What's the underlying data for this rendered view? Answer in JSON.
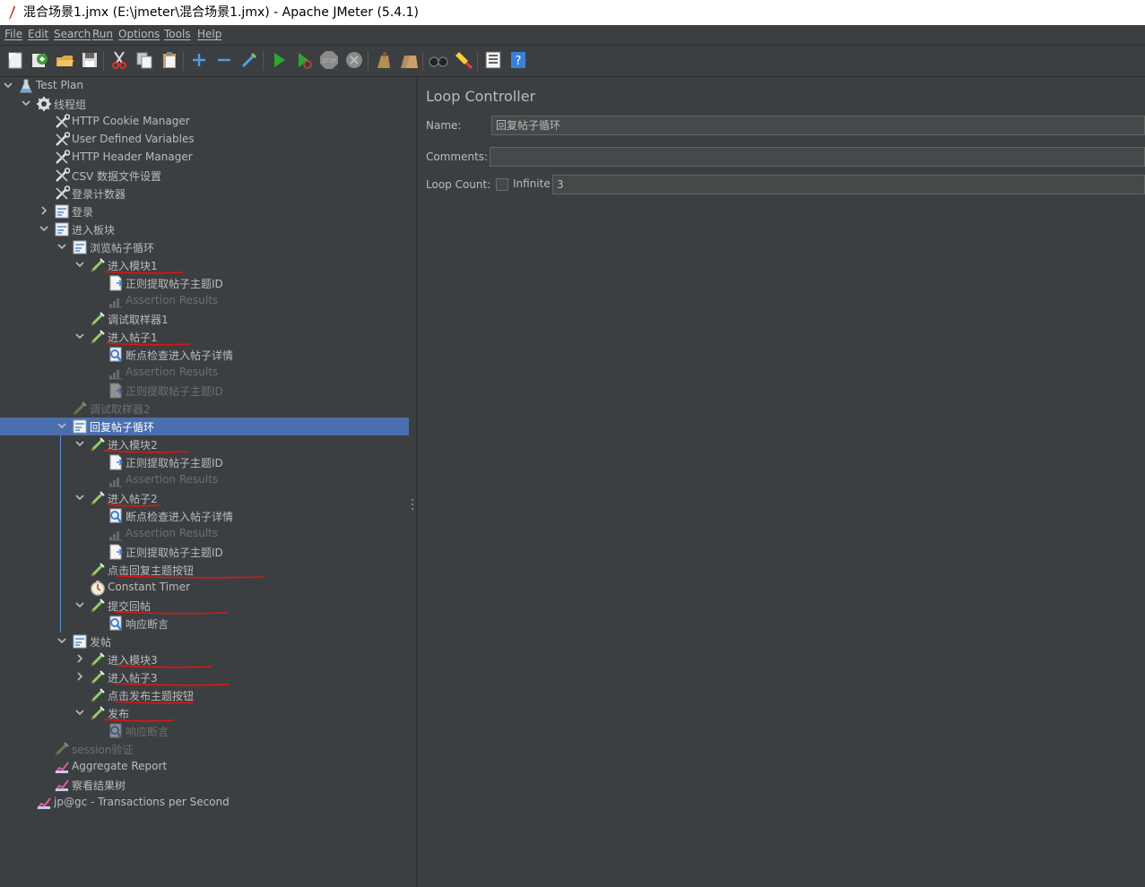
{
  "window": {
    "title": "混合场景1.jmx (E:\\jmeter\\混合场景1.jmx) - Apache JMeter (5.4.1)"
  },
  "menu": [
    "File",
    "Edit",
    "Search",
    "Run",
    "Options",
    "Tools",
    "Help"
  ],
  "toolbar": [
    "new-icon",
    "templates-icon",
    "open-icon",
    "save-icon",
    "cut-icon",
    "copy-icon",
    "paste-icon",
    "expand-icon",
    "collapse-icon",
    "toggle-icon",
    "start-icon",
    "start-no-timers-icon",
    "stop-icon",
    "shutdown-icon",
    "clear-icon",
    "clear-all-icon",
    "search-icon",
    "reset-search-icon",
    "function-helper-icon",
    "help-icon"
  ],
  "tree": [
    {
      "label": "Test Plan",
      "icon": "testplan-icon",
      "depth": 0,
      "arrow": "down",
      "disabled": false,
      "selected": false
    },
    {
      "label": "线程组",
      "icon": "gear-icon",
      "depth": 1,
      "arrow": "down",
      "disabled": false,
      "selected": false
    },
    {
      "label": "HTTP Cookie Manager",
      "icon": "wrench-icon",
      "depth": 2,
      "arrow": "",
      "disabled": false,
      "selected": false
    },
    {
      "label": "User Defined Variables",
      "icon": "wrench-icon",
      "depth": 2,
      "arrow": "",
      "disabled": false,
      "selected": false
    },
    {
      "label": "HTTP Header Manager",
      "icon": "wrench-icon",
      "depth": 2,
      "arrow": "",
      "disabled": false,
      "selected": false
    },
    {
      "label": "CSV 数据文件设置",
      "icon": "wrench-icon",
      "depth": 2,
      "arrow": "",
      "disabled": false,
      "selected": false
    },
    {
      "label": "登录计数器",
      "icon": "wrench-icon",
      "depth": 2,
      "arrow": "",
      "disabled": false,
      "selected": false
    },
    {
      "label": "登录",
      "icon": "controller-icon",
      "depth": 2,
      "arrow": "right",
      "disabled": false,
      "selected": false
    },
    {
      "label": "进入板块",
      "icon": "controller-icon",
      "depth": 2,
      "arrow": "down",
      "disabled": false,
      "selected": false
    },
    {
      "label": "浏览帖子循环",
      "icon": "controller-icon",
      "depth": 3,
      "arrow": "down",
      "disabled": false,
      "selected": false
    },
    {
      "label": "进入模块1",
      "icon": "sampler-icon",
      "depth": 4,
      "arrow": "down",
      "disabled": false,
      "selected": false
    },
    {
      "label": "正则提取帖子主题ID",
      "icon": "extractor-icon",
      "depth": 5,
      "arrow": "",
      "disabled": false,
      "selected": false
    },
    {
      "label": "Assertion Results",
      "icon": "chart-icon",
      "depth": 5,
      "arrow": "",
      "disabled": true,
      "selected": false
    },
    {
      "label": "调试取样器1",
      "icon": "sampler-icon",
      "depth": 4,
      "arrow": "",
      "disabled": false,
      "selected": false
    },
    {
      "label": "进入帖子1",
      "icon": "sampler-icon",
      "depth": 4,
      "arrow": "down",
      "disabled": false,
      "selected": false
    },
    {
      "label": "断点检查进入帖子详情",
      "icon": "assertion-icon",
      "depth": 5,
      "arrow": "",
      "disabled": false,
      "selected": false
    },
    {
      "label": "Assertion Results",
      "icon": "chart-icon",
      "depth": 5,
      "arrow": "",
      "disabled": true,
      "selected": false
    },
    {
      "label": "正则提取帖子主题ID",
      "icon": "extractor-icon",
      "depth": 5,
      "arrow": "",
      "disabled": true,
      "selected": false
    },
    {
      "label": "调试取样器2",
      "icon": "sampler-icon",
      "depth": 3,
      "arrow": "",
      "disabled": true,
      "selected": false
    },
    {
      "label": "回复帖子循环",
      "icon": "controller-icon",
      "depth": 3,
      "arrow": "down",
      "disabled": false,
      "selected": true
    },
    {
      "label": "进入模块2",
      "icon": "sampler-icon",
      "depth": 4,
      "arrow": "down",
      "disabled": false,
      "selected": false
    },
    {
      "label": "正则提取帖子主题ID",
      "icon": "extractor-icon",
      "depth": 5,
      "arrow": "",
      "disabled": false,
      "selected": false
    },
    {
      "label": "Assertion Results",
      "icon": "chart-icon",
      "depth": 5,
      "arrow": "",
      "disabled": true,
      "selected": false
    },
    {
      "label": "进入帖子2",
      "icon": "sampler-icon",
      "depth": 4,
      "arrow": "down",
      "disabled": false,
      "selected": false
    },
    {
      "label": "断点检查进入帖子详情",
      "icon": "assertion-icon",
      "depth": 5,
      "arrow": "",
      "disabled": false,
      "selected": false
    },
    {
      "label": "Assertion Results",
      "icon": "chart-icon",
      "depth": 5,
      "arrow": "",
      "disabled": true,
      "selected": false
    },
    {
      "label": "正则提取帖子主题ID",
      "icon": "extractor-icon",
      "depth": 5,
      "arrow": "",
      "disabled": false,
      "selected": false
    },
    {
      "label": "点击回复主题按钮",
      "icon": "sampler-icon",
      "depth": 4,
      "arrow": "",
      "disabled": false,
      "selected": false
    },
    {
      "label": "Constant Timer",
      "icon": "timer-icon",
      "depth": 4,
      "arrow": "",
      "disabled": false,
      "selected": false
    },
    {
      "label": "提交回帖",
      "icon": "sampler-icon",
      "depth": 4,
      "arrow": "down",
      "disabled": false,
      "selected": false
    },
    {
      "label": "响应断言",
      "icon": "assertion-icon",
      "depth": 5,
      "arrow": "",
      "disabled": false,
      "selected": false
    },
    {
      "label": "发帖",
      "icon": "controller-icon",
      "depth": 3,
      "arrow": "down",
      "disabled": false,
      "selected": false
    },
    {
      "label": "进入模块3",
      "icon": "sampler-icon",
      "depth": 4,
      "arrow": "right",
      "disabled": false,
      "selected": false
    },
    {
      "label": "进入帖子3",
      "icon": "sampler-icon",
      "depth": 4,
      "arrow": "right",
      "disabled": false,
      "selected": false
    },
    {
      "label": "点击发布主题按钮",
      "icon": "sampler-icon",
      "depth": 4,
      "arrow": "",
      "disabled": false,
      "selected": false
    },
    {
      "label": "发布",
      "icon": "sampler-icon",
      "depth": 4,
      "arrow": "down",
      "disabled": false,
      "selected": false
    },
    {
      "label": "响应断言",
      "icon": "assertion-icon",
      "depth": 5,
      "arrow": "",
      "disabled": true,
      "selected": false
    },
    {
      "label": "session验证",
      "icon": "sampler-icon",
      "depth": 2,
      "arrow": "",
      "disabled": true,
      "selected": false
    },
    {
      "label": "Aggregate Report",
      "icon": "chart-icon",
      "depth": 2,
      "arrow": "",
      "disabled": false,
      "selected": false
    },
    {
      "label": "察看结果树",
      "icon": "chart-icon",
      "depth": 2,
      "arrow": "",
      "disabled": false,
      "selected": false
    },
    {
      "label": "jp@gc - Transactions per Second",
      "icon": "chart-icon",
      "depth": 1,
      "arrow": "",
      "disabled": false,
      "selected": false
    }
  ],
  "panel": {
    "title": "Loop Controller",
    "name_label": "Name:",
    "name_value": "回复帖子循环",
    "comments_label": "Comments:",
    "comments_value": "",
    "loop_count_label": "Loop Count:",
    "infinite_label": "Infinite",
    "infinite_checked": false,
    "loop_count_value": "3"
  },
  "colors": {
    "background": "#3c3f41",
    "selection": "#4b6eaf",
    "annotation": "#e01414"
  }
}
